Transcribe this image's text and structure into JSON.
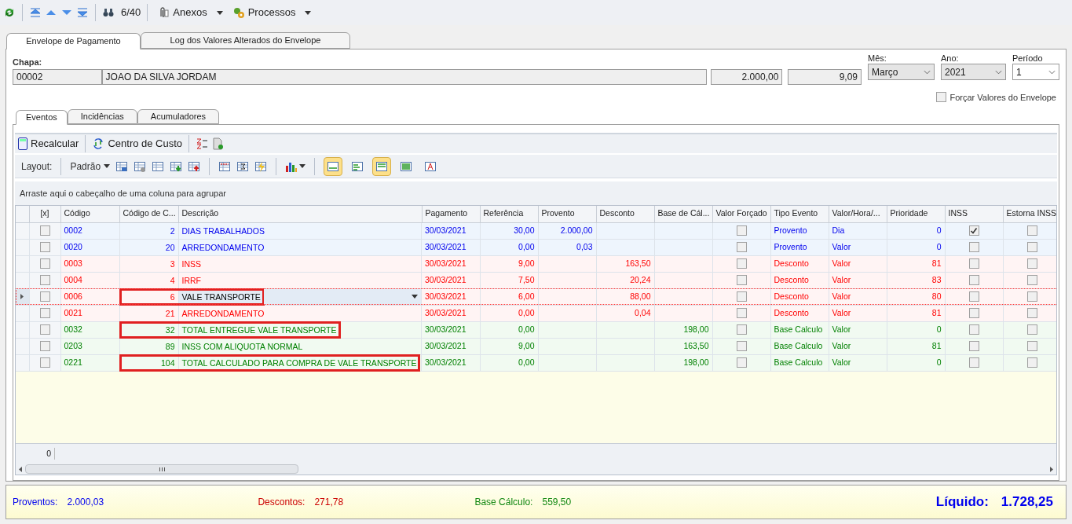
{
  "toolbar": {
    "counter": "6/40",
    "menus": [
      {
        "kind": "attach",
        "label": "Anexos"
      },
      {
        "kind": "process",
        "label": "Processos"
      }
    ]
  },
  "main_tabs": [
    {
      "label": "Envelope de Pagamento",
      "selected": true
    },
    {
      "label": "Log dos Valores Alterados do Envelope",
      "selected": false
    }
  ],
  "header": {
    "chapa_label": "Chapa:",
    "chapa": "00002",
    "name": "JOAO DA SILVA JORDAM",
    "salary": "2.000,00",
    "hour_value": "9,09",
    "month": {
      "label": "Mês:",
      "value": "Março"
    },
    "year": {
      "label": "Ano:",
      "value": "2021"
    },
    "period": {
      "label": "Período",
      "value": "1"
    },
    "force_values": {
      "label": "Forçar Valores do Envelope",
      "checked": false
    }
  },
  "sub_tabs": [
    {
      "label": "Eventos",
      "selected": true
    },
    {
      "label": "Incidências",
      "selected": false
    },
    {
      "label": "Acumuladores",
      "selected": false
    }
  ],
  "actions": [
    "Recalcular",
    "Centro de Custo"
  ],
  "layout_bar": {
    "label": "Layout:",
    "preset": "Padrão",
    "view_buttons": [
      {
        "pressed": true
      },
      {
        "pressed": false
      },
      {
        "pressed": true
      },
      {
        "pressed": false
      },
      {
        "pressed": false
      }
    ]
  },
  "group_hint": "Arraste aqui o cabeçalho de uma coluna para agrupar",
  "columns": [
    "[x]",
    "Código",
    "Código de C...",
    "Descrição",
    "Pagamento",
    "Referência",
    "Provento",
    "Desconto",
    "Base de Cál...",
    "Valor Forçado",
    "Tipo Evento",
    "Valor/Hora/...",
    "Prioridade",
    "INSS",
    "Estorna INSS"
  ],
  "rows": [
    {
      "kind": "provento",
      "current": false,
      "highlighted": false,
      "x": false,
      "codigo": "0002",
      "codigo_c": "2",
      "descricao": "DIAS TRABALHADOS",
      "pagamento": "30/03/2021",
      "referencia": "30,00",
      "provento": "2.000,00",
      "desconto": "",
      "base": "",
      "forcado": false,
      "tipo": "Provento",
      "valor_hora": "Dia",
      "prioridade": "0",
      "inss": true,
      "estorna": false
    },
    {
      "kind": "provento",
      "current": false,
      "highlighted": false,
      "x": false,
      "codigo": "0020",
      "codigo_c": "20",
      "descricao": "ARREDONDAMENTO",
      "pagamento": "30/03/2021",
      "referencia": "0,00",
      "provento": "0,03",
      "desconto": "",
      "base": "",
      "forcado": false,
      "tipo": "Provento",
      "valor_hora": "Valor",
      "prioridade": "0",
      "inss": false,
      "estorna": false
    },
    {
      "kind": "desconto",
      "current": false,
      "highlighted": false,
      "x": false,
      "codigo": "0003",
      "codigo_c": "3",
      "descricao": "INSS",
      "pagamento": "30/03/2021",
      "referencia": "9,00",
      "provento": "",
      "desconto": "163,50",
      "base": "",
      "forcado": false,
      "tipo": "Desconto",
      "valor_hora": "Valor",
      "prioridade": "81",
      "inss": false,
      "estorna": false
    },
    {
      "kind": "desconto",
      "current": false,
      "highlighted": false,
      "x": false,
      "codigo": "0004",
      "codigo_c": "4",
      "descricao": "IRRF",
      "pagamento": "30/03/2021",
      "referencia": "7,50",
      "provento": "",
      "desconto": "20,24",
      "base": "",
      "forcado": false,
      "tipo": "Desconto",
      "valor_hora": "Valor",
      "prioridade": "83",
      "inss": false,
      "estorna": false
    },
    {
      "kind": "desconto",
      "current": true,
      "highlighted": true,
      "x": false,
      "codigo": "0006",
      "codigo_c": "6",
      "descricao": "VALE TRANSPORTE",
      "pagamento": "30/03/2021",
      "referencia": "6,00",
      "provento": "",
      "desconto": "88,00",
      "base": "",
      "forcado": false,
      "tipo": "Desconto",
      "valor_hora": "Valor",
      "prioridade": "80",
      "inss": false,
      "estorna": false
    },
    {
      "kind": "desconto",
      "current": false,
      "highlighted": false,
      "x": false,
      "codigo": "0021",
      "codigo_c": "21",
      "descricao": "ARREDONDAMENTO",
      "pagamento": "30/03/2021",
      "referencia": "0,00",
      "provento": "",
      "desconto": "0,04",
      "base": "",
      "forcado": false,
      "tipo": "Desconto",
      "valor_hora": "Valor",
      "prioridade": "81",
      "inss": false,
      "estorna": false
    },
    {
      "kind": "base",
      "current": false,
      "highlighted": true,
      "x": false,
      "codigo": "0032",
      "codigo_c": "32",
      "descricao": "TOTAL ENTREGUE VALE TRANSPORTE",
      "pagamento": "30/03/2021",
      "referencia": "0,00",
      "provento": "",
      "desconto": "",
      "base": "198,00",
      "forcado": false,
      "tipo": "Base Calculo",
      "valor_hora": "Valor",
      "prioridade": "0",
      "inss": false,
      "estorna": false
    },
    {
      "kind": "base",
      "current": false,
      "highlighted": false,
      "x": false,
      "codigo": "0203",
      "codigo_c": "89",
      "descricao": "INSS COM ALIQUOTA NORMAL",
      "pagamento": "30/03/2021",
      "referencia": "9,00",
      "provento": "",
      "desconto": "",
      "base": "163,50",
      "forcado": false,
      "tipo": "Base Calculo",
      "valor_hora": "Valor",
      "prioridade": "81",
      "inss": false,
      "estorna": false
    },
    {
      "kind": "base",
      "current": false,
      "highlighted": true,
      "x": false,
      "codigo": "0221",
      "codigo_c": "104",
      "descricao": "TOTAL CALCULADO PARA COMPRA DE VALE TRANSPORTE",
      "pagamento": "30/03/2021",
      "referencia": "0,00",
      "provento": "",
      "desconto": "",
      "base": "198,00",
      "forcado": false,
      "tipo": "Base Calculo",
      "valor_hora": "Valor",
      "prioridade": "0",
      "inss": false,
      "estorna": false
    }
  ],
  "footer_count": "0",
  "totals": {
    "proventos_label": "Proventos:",
    "proventos": "2.000,03",
    "descontos_label": "Descontos:",
    "descontos": "271,78",
    "base_label": "Base Cálculo:",
    "base": "559,50",
    "liquido_label": "Líquido:",
    "liquido": "1.728,25"
  }
}
